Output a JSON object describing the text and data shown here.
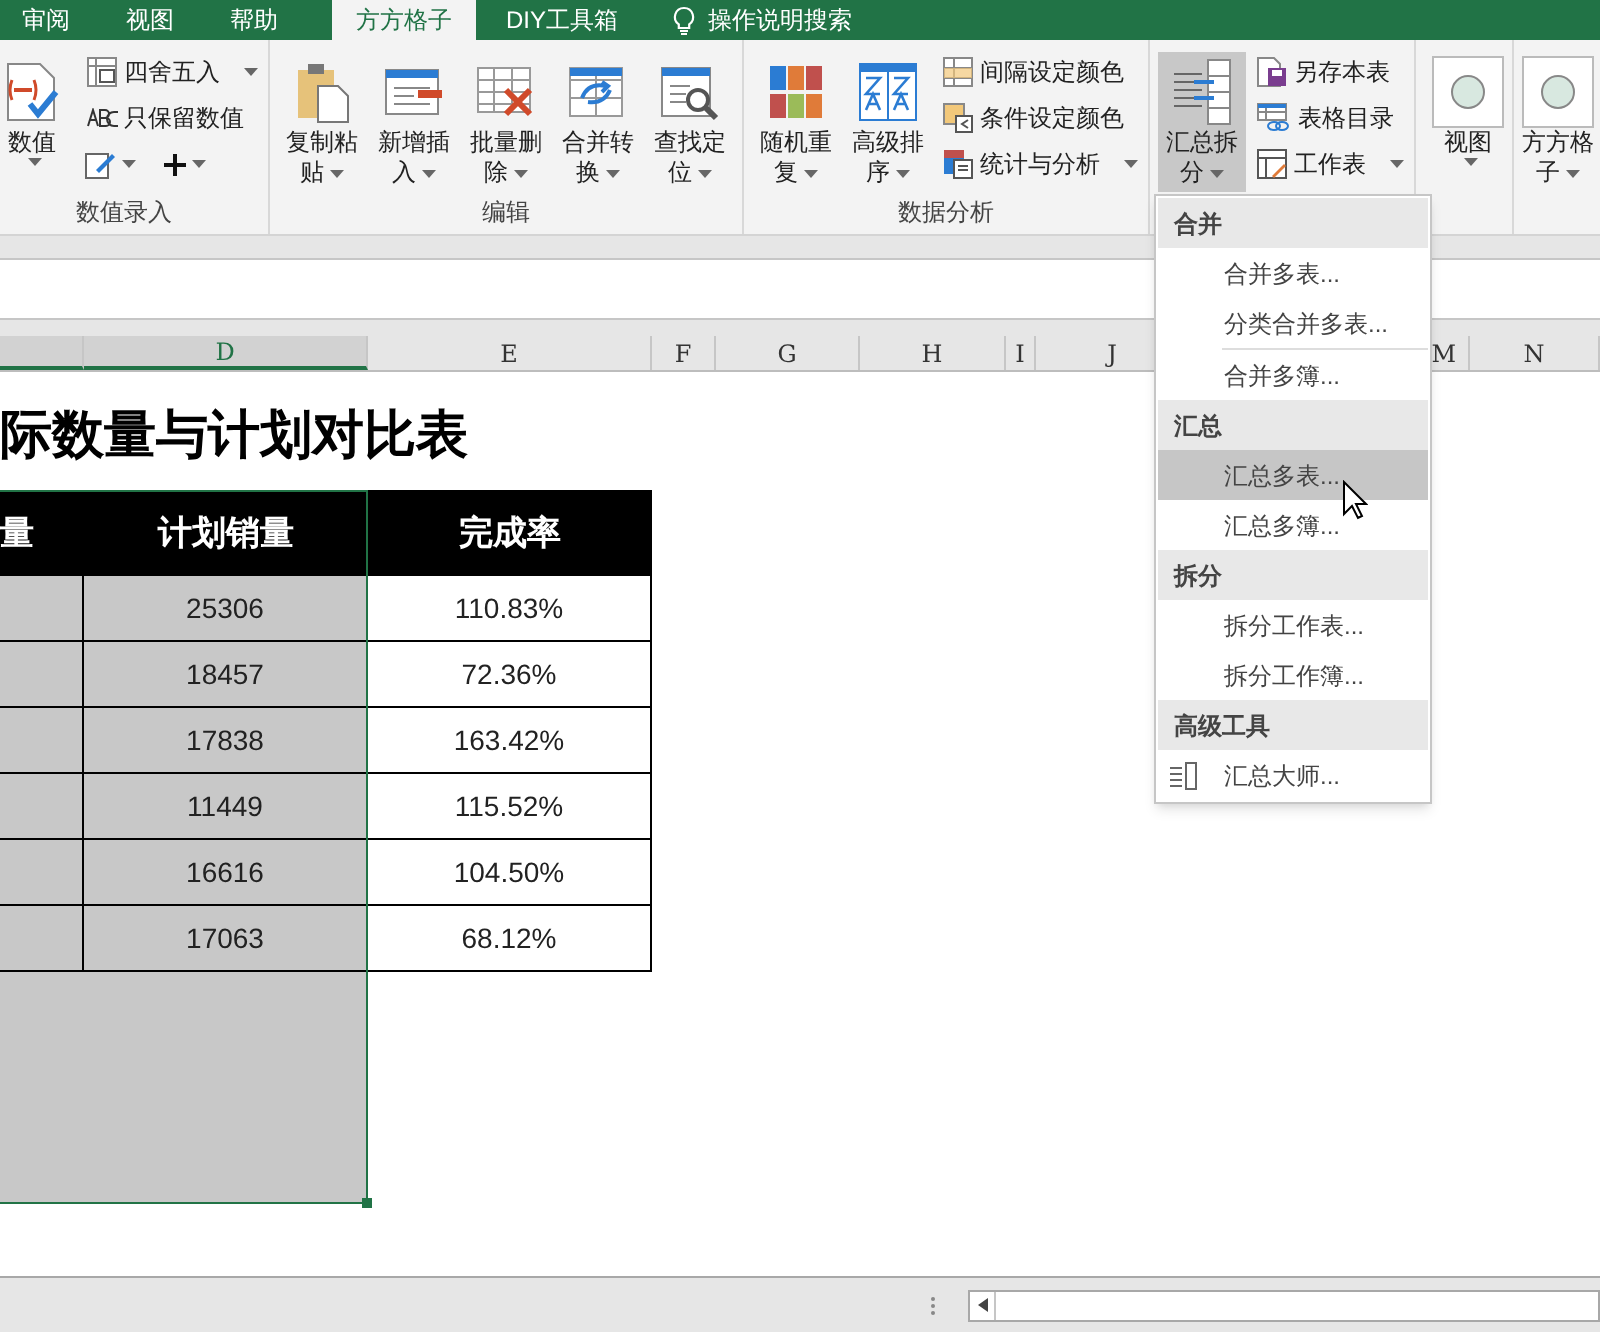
{
  "tabs": [
    {
      "label": "审阅",
      "selected": false
    },
    {
      "label": "视图",
      "selected": false
    },
    {
      "label": "帮助",
      "selected": false
    },
    {
      "label": "方方格子",
      "selected": true
    },
    {
      "label": "DIY工具箱",
      "selected": false
    }
  ],
  "search": {
    "label": "操作说明搜索"
  },
  "ribbon_groups": [
    {
      "label": "数值录入",
      "items": [
        {
          "kind": "large",
          "label": "数值",
          "dropdown": true,
          "pressed": false
        },
        {
          "kind": "small",
          "label": "四舍五入",
          "dropdown": true
        },
        {
          "kind": "small",
          "label": "只保留数值",
          "dropdown": false
        },
        {
          "kind": "iconrow"
        }
      ]
    },
    {
      "label": "编辑",
      "items": [
        {
          "kind": "large",
          "label": "复制粘贴",
          "dropdown": true,
          "pressed": false
        },
        {
          "kind": "large",
          "label": "新增插入",
          "dropdown": true,
          "pressed": false
        },
        {
          "kind": "large",
          "label": "批量删除",
          "dropdown": true,
          "pressed": false
        },
        {
          "kind": "large",
          "label": "合并转换",
          "dropdown": true,
          "pressed": false
        },
        {
          "kind": "large",
          "label": "查找定位",
          "dropdown": true,
          "pressed": false
        }
      ]
    },
    {
      "label": "数据分析",
      "items": [
        {
          "kind": "large",
          "label": "随机重复",
          "dropdown": true,
          "pressed": false
        },
        {
          "kind": "large",
          "label": "高级排序",
          "dropdown": true,
          "pressed": false
        },
        {
          "kind": "small",
          "label": "间隔设定颜色",
          "dropdown": false
        },
        {
          "kind": "small",
          "label": "条件设定颜色",
          "dropdown": false
        },
        {
          "kind": "small",
          "label": "统计与分析",
          "dropdown": true
        }
      ]
    },
    {
      "items": [
        {
          "kind": "large",
          "label": "汇总拆分",
          "dropdown": true,
          "pressed": true
        },
        {
          "kind": "small",
          "label": "另存本表",
          "dropdown": false
        },
        {
          "kind": "small",
          "label": "表格目录",
          "dropdown": false
        },
        {
          "kind": "small",
          "label": "工作表",
          "dropdown": true
        }
      ]
    },
    {
      "items": [
        {
          "kind": "large",
          "label": "视图",
          "dropdown": true,
          "pressed": false
        }
      ]
    },
    {
      "items": [
        {
          "kind": "large",
          "label": "方方格子",
          "dropdown": true,
          "pressed": false
        }
      ]
    }
  ],
  "columns": [
    {
      "selected": true
    },
    {
      "label": "D",
      "selected": true
    },
    {
      "label": "E",
      "selected": false
    },
    {
      "label": "F",
      "selected": false
    },
    {
      "label": "G",
      "selected": false
    },
    {
      "label": "H",
      "selected": false
    },
    {
      "label": "I",
      "selected": false
    },
    {
      "label": "J",
      "selected": false
    },
    {
      "label": "M",
      "selected": false
    },
    {
      "label": "N",
      "selected": false
    }
  ],
  "sheet_title": "际数量与计划对比表",
  "table": {
    "columns": [
      "量",
      "计划销量",
      "完成率"
    ],
    "rows": [
      [
        null,
        "25306",
        "110.83%"
      ],
      [
        null,
        "18457",
        "72.36%"
      ],
      [
        null,
        "17838",
        "163.42%"
      ],
      [
        null,
        "11449",
        "115.52%"
      ],
      [
        null,
        "16616",
        "104.50%"
      ],
      [
        null,
        "17063",
        "68.12%"
      ]
    ]
  },
  "menu": {
    "sections": [
      {
        "heading": "合并",
        "items": [
          {
            "kind": "plain",
            "label": "合并多表...",
            "selected": false
          },
          {
            "kind": "plain",
            "label": "分类合并多表...",
            "selected": false
          },
          {
            "kind": "plain",
            "label": "合并多簿...",
            "selected": false
          }
        ]
      },
      {
        "heading": "汇总",
        "items": [
          {
            "kind": "plain",
            "label": "汇总多表...",
            "selected": true
          },
          {
            "kind": "plain",
            "label": "汇总多簿...",
            "selected": false
          }
        ]
      },
      {
        "heading": "拆分",
        "items": [
          {
            "kind": "plain",
            "label": "拆分工作表...",
            "selected": false
          },
          {
            "kind": "plain",
            "label": "拆分工作簿...",
            "selected": false
          }
        ]
      },
      {
        "heading": "高级工具",
        "items": [
          {
            "kind": "tool",
            "label": "汇总大师...",
            "selected": false
          }
        ]
      }
    ]
  }
}
